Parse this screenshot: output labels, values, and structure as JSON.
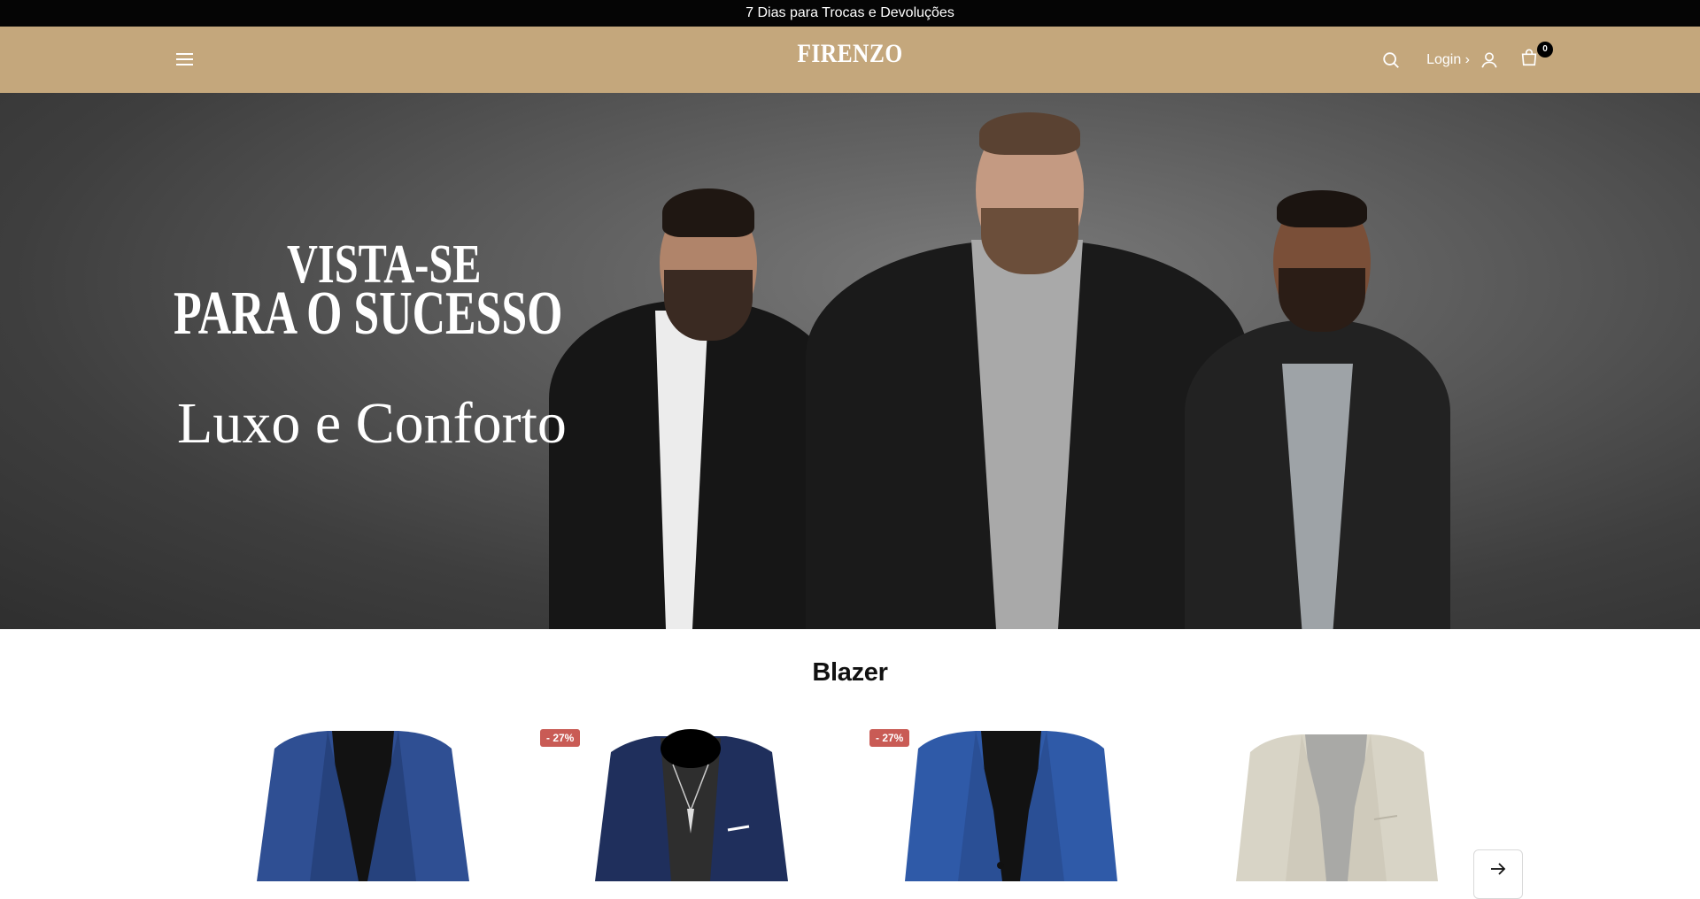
{
  "announcement": {
    "text": "7 Dias para Trocas e Devoluções"
  },
  "header": {
    "logo": "FIRENZO",
    "login_label": "Login ›",
    "cart_count": "0"
  },
  "hero": {
    "line1": "VISTA-SE",
    "line2": "PARA O SUCESSO",
    "subtitle": "Luxo e Conforto"
  },
  "collection": {
    "title": "Blazer",
    "products": [
      {
        "badge": "",
        "color": "#2f4f93"
      },
      {
        "badge": "- 27%",
        "color": "#1f2f5c"
      },
      {
        "badge": "- 27%",
        "color": "#2f5aa8"
      },
      {
        "badge": "",
        "color": "#d8d4c6"
      }
    ]
  },
  "colors": {
    "header_bg": "#c4a77c",
    "announcement_bg": "#050505",
    "badge_bg": "#c95b55"
  },
  "icons": [
    "menu-icon",
    "search-icon",
    "user-icon",
    "cart-icon",
    "arrow-right-icon"
  ]
}
